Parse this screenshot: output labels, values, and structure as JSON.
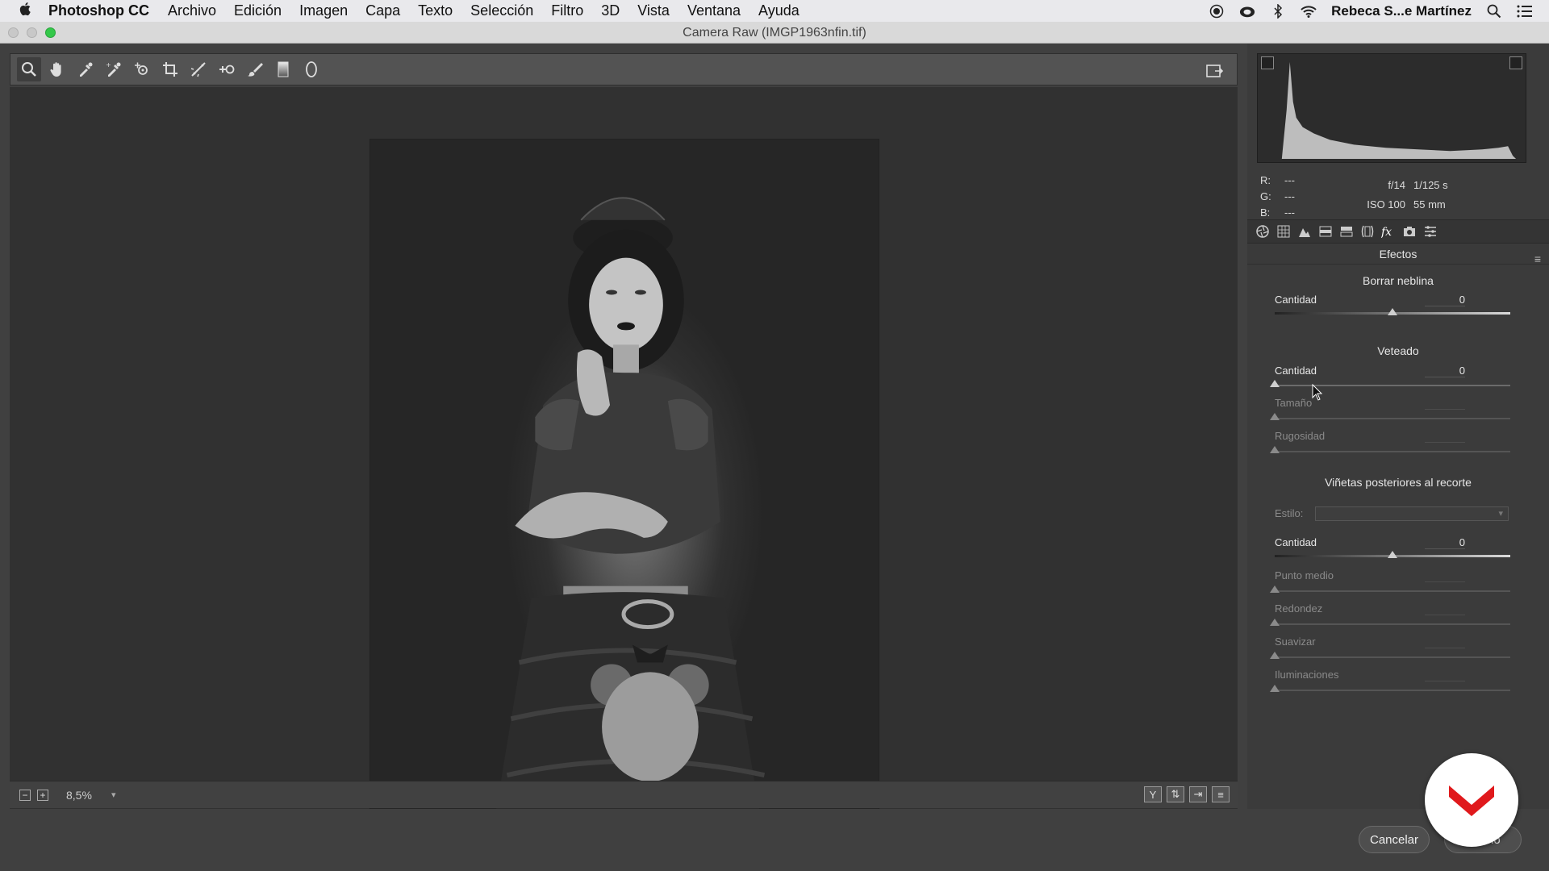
{
  "menubar": {
    "app_name": "Photoshop CC",
    "items": [
      "Archivo",
      "Edición",
      "Imagen",
      "Capa",
      "Texto",
      "Selección",
      "Filtro",
      "3D",
      "Vista",
      "Ventana",
      "Ayuda"
    ],
    "user": "Rebeca S...e Martínez"
  },
  "window": {
    "title": "Camera Raw (IMGP1963nfin.tif)"
  },
  "toolbar": {
    "tools": [
      "zoom-icon",
      "hand-icon",
      "white-balance-icon",
      "color-sampler-icon",
      "targeted-adjustment-icon",
      "crop-icon",
      "spot-removal-icon",
      "red-eye-icon",
      "adjustment-brush-icon",
      "graduated-filter-icon",
      "radial-filter-icon"
    ],
    "active_tool": "zoom-icon"
  },
  "statusbar": {
    "zoom": "8,5%"
  },
  "readout": {
    "r_label": "R:",
    "r_value": "---",
    "g_label": "G:",
    "g_value": "---",
    "b_label": "B:",
    "b_value": "---",
    "aperture": "f/14",
    "shutter": "1/125 s",
    "iso": "ISO 100",
    "focal": "55 mm"
  },
  "panel": {
    "title": "Efectos",
    "dehaze": {
      "section": "Borrar neblina",
      "amount_label": "Cantidad",
      "amount_value": "0",
      "amount_level": 0.5
    },
    "grain": {
      "section": "Veteado",
      "amount_label": "Cantidad",
      "amount_value": "0",
      "size_label": "Tamaño",
      "roughness_label": "Rugosidad"
    },
    "vignette": {
      "section": "Viñetas posteriores al recorte",
      "style_label": "Estilo:",
      "amount_label": "Cantidad",
      "amount_value": "0",
      "amount_level": 0.5,
      "midpoint_label": "Punto medio",
      "roundness_label": "Redondez",
      "feather_label": "Suavizar",
      "highlights_label": "Iluminaciones"
    }
  },
  "buttons": {
    "cancel": "Cancelar",
    "done": "Hecho"
  },
  "colors": {
    "accent_logo": "#e0191c",
    "panel_bg": "#3b3b3b",
    "canvas_bg": "#313131"
  }
}
